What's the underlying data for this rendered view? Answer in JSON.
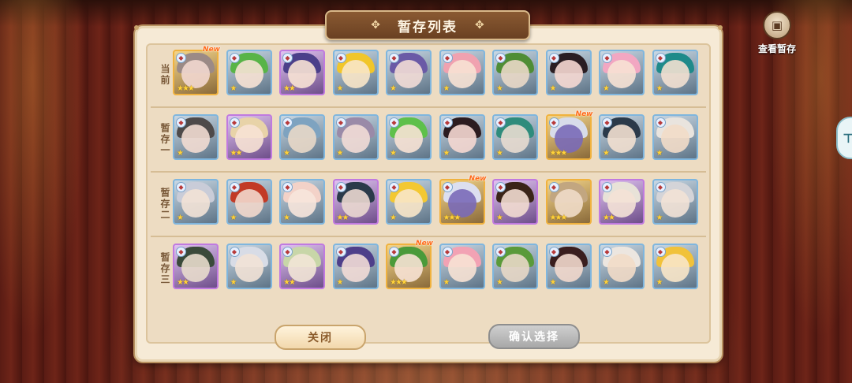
{
  "title": "暂存列表",
  "view_stash": {
    "icon": "treasure-box-icon",
    "label": "查看暂存"
  },
  "side_tab": {
    "icon": "side-tab-icon"
  },
  "buttons": {
    "close": "关闭",
    "confirm": "确认选择"
  },
  "colors": {
    "gold_border": "#f0b23e",
    "purple_border": "#c07ae0",
    "blue_border": "#7fb6de",
    "confirm_disabled": "#a8a8a8"
  },
  "new_label": "New",
  "rows": [
    {
      "label": "当前",
      "cards": [
        {
          "rarity": "gold",
          "stars": "★★★",
          "new": true,
          "hair": "#9b8a86",
          "face": "#f2d7cf"
        },
        {
          "rarity": "blue",
          "stars": "★",
          "new": false,
          "hair": "#58b447",
          "face": "#f7e2d4"
        },
        {
          "rarity": "purple",
          "stars": "★★",
          "new": false,
          "hair": "#4b3f8a",
          "face": "#f7e2d4"
        },
        {
          "rarity": "blue",
          "stars": "★",
          "new": false,
          "hair": "#f1c62a",
          "face": "#f8e6c8"
        },
        {
          "rarity": "blue",
          "stars": "★",
          "new": false,
          "hair": "#6a5aa6",
          "face": "#f2dcd6"
        },
        {
          "rarity": "blue",
          "stars": "★",
          "new": false,
          "hair": "#f0a2b0",
          "face": "#f7e2d4"
        },
        {
          "rarity": "blue",
          "stars": "★",
          "new": false,
          "hair": "#4f8d36",
          "face": "#e9d8c6"
        },
        {
          "rarity": "blue",
          "stars": "★",
          "new": false,
          "hair": "#2a1d22",
          "face": "#f5d8d2"
        },
        {
          "rarity": "blue",
          "stars": "★",
          "new": false,
          "hair": "#f2a7c2",
          "face": "#f7e2d4"
        },
        {
          "rarity": "blue",
          "stars": "★",
          "new": false,
          "hair": "#1f8a8a",
          "face": "#f2e0d0"
        }
      ]
    },
    {
      "label": "暂存一",
      "cards": [
        {
          "rarity": "blue",
          "stars": "★",
          "new": false,
          "hair": "#4e4a4a",
          "face": "#f2dcd2"
        },
        {
          "rarity": "purple",
          "stars": "★★",
          "new": false,
          "hair": "#e8d3a8",
          "face": "#f7e2d4"
        },
        {
          "rarity": "blue",
          "stars": "★",
          "new": false,
          "hair": "#7ea3c0",
          "face": "#e8d8c8"
        },
        {
          "rarity": "blue",
          "stars": "★",
          "new": false,
          "hair": "#9a8aa8",
          "face": "#f2dcd6"
        },
        {
          "rarity": "blue",
          "stars": "★",
          "new": false,
          "hair": "#5ec04a",
          "face": "#f7e2d4"
        },
        {
          "rarity": "blue",
          "stars": "★",
          "new": false,
          "hair": "#2c1c20",
          "face": "#f5d8d2"
        },
        {
          "rarity": "blue",
          "stars": "★",
          "new": false,
          "hair": "#2f8c7c",
          "face": "#e8dcd0"
        },
        {
          "rarity": "gold",
          "stars": "★★★",
          "new": true,
          "hair": "#d8dcea",
          "face": "#7a6ab8"
        },
        {
          "rarity": "blue",
          "stars": "★",
          "new": false,
          "hair": "#2b3a4a",
          "face": "#f2e0d0"
        },
        {
          "rarity": "blue",
          "stars": "★",
          "new": false,
          "hair": "#e9e4de",
          "face": "#f2dcc8"
        }
      ]
    },
    {
      "label": "暂存二",
      "cards": [
        {
          "rarity": "blue",
          "stars": "★",
          "new": false,
          "hair": "#c9ccd8",
          "face": "#f2e2d6"
        },
        {
          "rarity": "blue",
          "stars": "★",
          "new": false,
          "hair": "#c23a26",
          "face": "#f2d8cc"
        },
        {
          "rarity": "blue",
          "stars": "★",
          "new": false,
          "hair": "#f3d2c8",
          "face": "#f7e6dc"
        },
        {
          "rarity": "purple",
          "stars": "★★",
          "new": false,
          "hair": "#2a3a4a",
          "face": "#ead8d0"
        },
        {
          "rarity": "blue",
          "stars": "★",
          "new": false,
          "hair": "#f3c832",
          "face": "#f8e6c8"
        },
        {
          "rarity": "gold",
          "stars": "★★★",
          "new": true,
          "hair": "#dcdff0",
          "face": "#7a6ab8"
        },
        {
          "rarity": "purple",
          "stars": "★",
          "new": false,
          "hair": "#3a2418",
          "face": "#f2dcd0"
        },
        {
          "rarity": "gold",
          "stars": "★★★",
          "new": false,
          "hair": "#c2a680",
          "face": "#f0dcc8"
        },
        {
          "rarity": "purple",
          "stars": "★★",
          "new": false,
          "hair": "#e8e2d8",
          "face": "#f4e2d6"
        },
        {
          "rarity": "blue",
          "stars": "★",
          "new": false,
          "hair": "#d4d4d8",
          "face": "#f2e2d6"
        }
      ]
    },
    {
      "label": "暂存三",
      "cards": [
        {
          "rarity": "purple",
          "stars": "★★",
          "new": false,
          "hair": "#3a4a3a",
          "face": "#e8dccc"
        },
        {
          "rarity": "blue",
          "stars": "★",
          "new": false,
          "hair": "#d8dce6",
          "face": "#f2e2d6"
        },
        {
          "rarity": "purple",
          "stars": "★★",
          "new": false,
          "hair": "#c8d6a8",
          "face": "#f2e6d6"
        },
        {
          "rarity": "blue",
          "stars": "★",
          "new": false,
          "hair": "#4e3f8a",
          "face": "#f2dcd6"
        },
        {
          "rarity": "gold",
          "stars": "★★★",
          "new": true,
          "hair": "#4a9a3a",
          "face": "#f7e2d4"
        },
        {
          "rarity": "blue",
          "stars": "★",
          "new": false,
          "hair": "#f2a2b4",
          "face": "#f7e2d4"
        },
        {
          "rarity": "blue",
          "stars": "★",
          "new": false,
          "hair": "#5a9a3a",
          "face": "#e8d8c6"
        },
        {
          "rarity": "blue",
          "stars": "★",
          "new": false,
          "hair": "#3a1e1e",
          "face": "#f2d8cc"
        },
        {
          "rarity": "blue",
          "stars": "★",
          "new": false,
          "hair": "#ece6e0",
          "face": "#f2dcc8"
        },
        {
          "rarity": "blue",
          "stars": "★",
          "new": false,
          "hair": "#f1c23a",
          "face": "#f8e6c8"
        }
      ]
    }
  ]
}
